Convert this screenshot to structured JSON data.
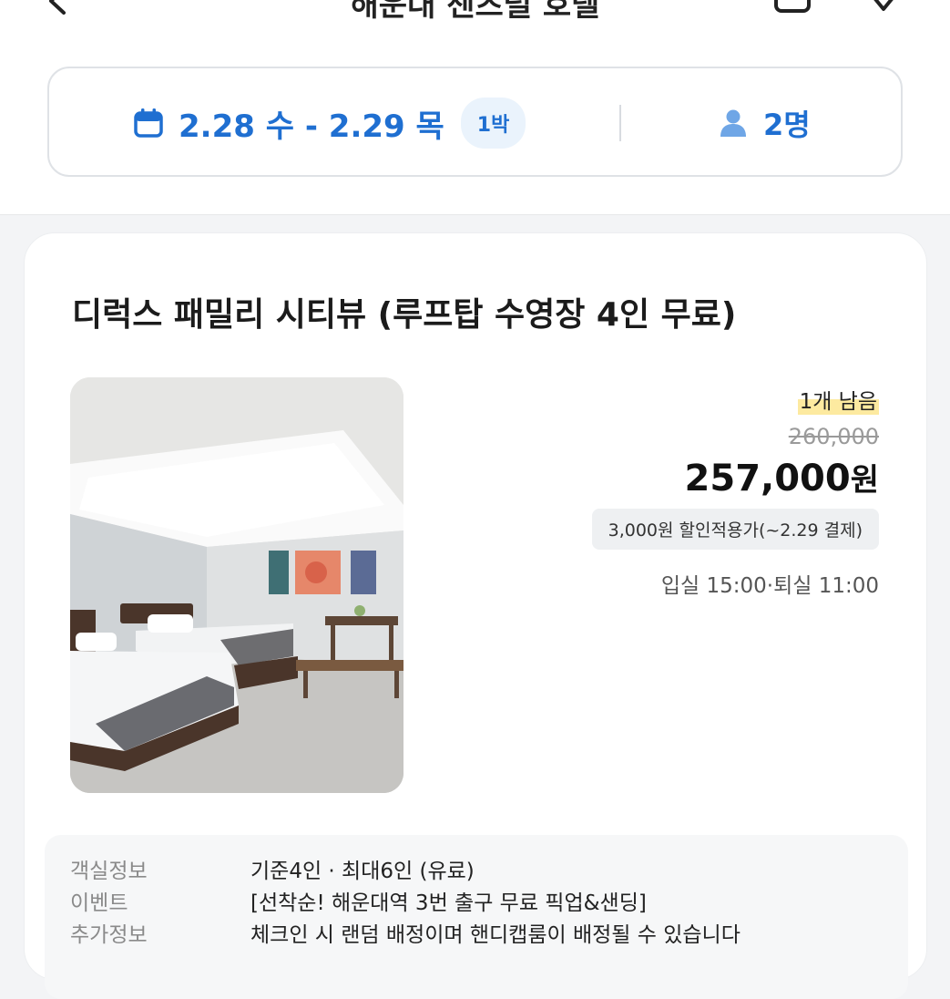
{
  "header": {
    "title": "해운대 센츠럴 호텔"
  },
  "search": {
    "dates": "2.28 수 - 2.29 목",
    "nights": "1박",
    "guests": "2명"
  },
  "room": {
    "title": "디럭스 패밀리 시티뷰 (루프탑 수영장 4인 무료)",
    "remaining": "1개 남음",
    "original_price": "260,000",
    "price": "257,000",
    "currency": "원",
    "discount": "3,000원 할인적용가(~2.29 결제)",
    "checkin_checkout": "입실 15:00·퇴실 11:00"
  },
  "details": [
    {
      "label": "객실정보",
      "value": "기준4인 · 최대6인 (유료)"
    },
    {
      "label": "이벤트",
      "value": "[선착순! 해운대역 3번 출구 무료 픽업&샌딩]"
    },
    {
      "label": "추가정보",
      "value": "체크인 시 랜덤 배정이며 핸디캡룸이 배정될 수 있습니다"
    }
  ],
  "colors": {
    "accent": "#1f6fd1",
    "badge_bg": "#eaf3fc",
    "highlight": "#fdeaa0"
  }
}
